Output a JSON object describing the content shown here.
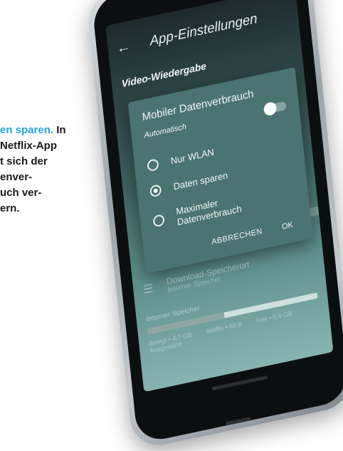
{
  "caption": {
    "highlight": "en sparen.",
    "lines": [
      "In",
      "Netflix-App",
      "t sich der",
      "enver-",
      "uch ver-",
      "ern."
    ]
  },
  "app": {
    "title": "App-Einstellungen",
    "section": "Video-Wiedergabe",
    "download": {
      "label": "Download-Speicherort",
      "sublabel": "Interner Speicher"
    },
    "storage": {
      "label": "Interner Speicher",
      "used_fraction": 0.45,
      "legend": [
        "Belegt • 4,7 GB",
        "Netflix • 68 B",
        "Frei • 5,4 GB"
      ],
      "action": "Ausgewählt"
    }
  },
  "dialog": {
    "title": "Mobiler Datenverbrauch",
    "auto_label": "Automatisch",
    "auto_enabled": true,
    "options": [
      {
        "label": "Nur WLAN",
        "checked": false
      },
      {
        "label": "Daten sparen",
        "checked": true
      },
      {
        "label_line1": "Maximaler",
        "label_line2": "Datenverbrauch",
        "checked": false
      }
    ],
    "cancel_label": "ABBRECHEN",
    "ok_label": "OK"
  },
  "colors": {
    "highlight": "#27a3d9",
    "dialog_bg": "#4a7371"
  }
}
